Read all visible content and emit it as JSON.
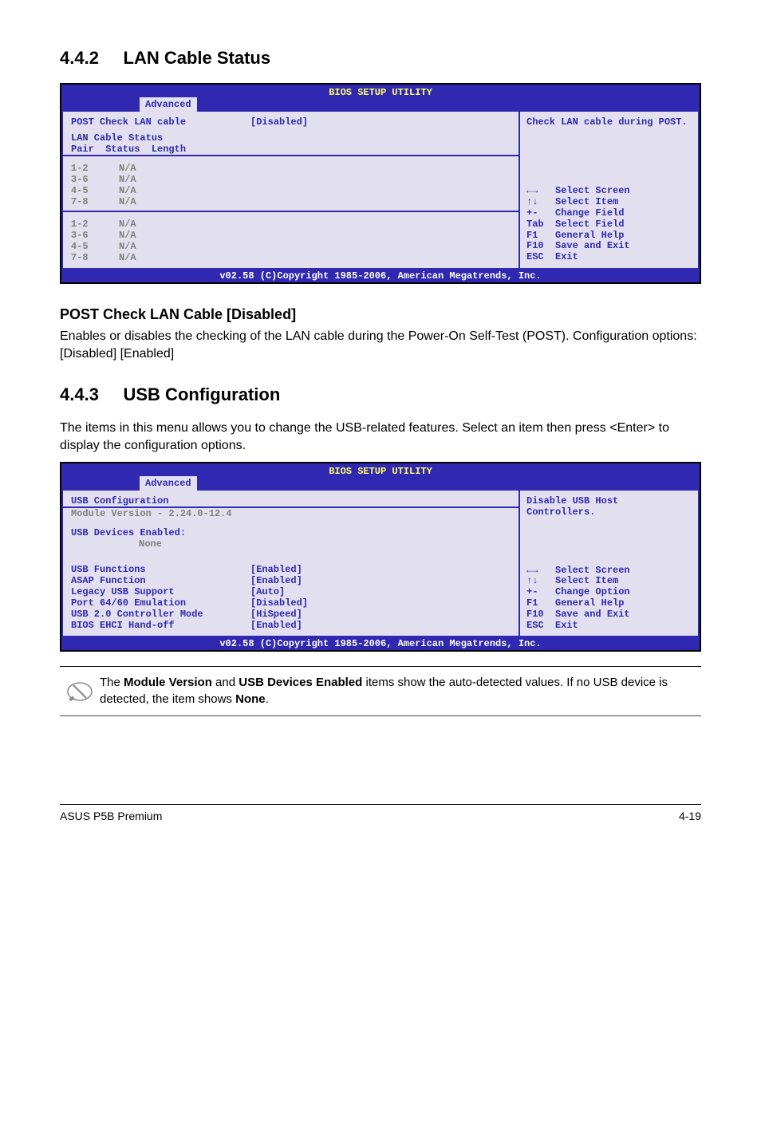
{
  "section1": {
    "num": "4.4.2",
    "title": "LAN Cable Status"
  },
  "bios1": {
    "title": "BIOS SETUP UTILITY",
    "tab": "Advanced",
    "left": {
      "post_check_label": "POST Check LAN cable",
      "post_check_value": "[Disabled]",
      "lan_status_hdr": "LAN Cable Status",
      "col_hdr": "Pair  Status  Length",
      "pairs1": [
        {
          "p": "1-2",
          "s": "N/A"
        },
        {
          "p": "3-6",
          "s": "N/A"
        },
        {
          "p": "4-5",
          "s": "N/A"
        },
        {
          "p": "7-8",
          "s": "N/A"
        }
      ],
      "pairs2": [
        {
          "p": "1-2",
          "s": "N/A"
        },
        {
          "p": "3-6",
          "s": "N/A"
        },
        {
          "p": "4-5",
          "s": "N/A"
        },
        {
          "p": "7-8",
          "s": "N/A"
        }
      ]
    },
    "right": {
      "help": "Check LAN cable during POST.",
      "keys": "←→   Select Screen\n↑↓   Select Item\n+-   Change Field\nTab  Select Field\nF1   General Help\nF10  Save and Exit\nESC  Exit"
    },
    "footer": "v02.58 (C)Copyright 1985-2006, American Megatrends, Inc."
  },
  "sub1": {
    "heading": "POST Check LAN Cable [Disabled]",
    "text": "Enables or disables the checking of the LAN cable during the Power-On Self-Test (POST). Configuration options: [Disabled] [Enabled]"
  },
  "section2": {
    "num": "4.4.3",
    "title": "USB Configuration"
  },
  "s2text": "The items in this menu allows you to change the USB-related features. Select an item then press <Enter> to display the configuration options.",
  "bios2": {
    "title": "BIOS SETUP UTILITY",
    "tab": "Advanced",
    "left": {
      "hdr": "USB Configuration",
      "module": "Module Version - 2.24.0-12.4",
      "dev_hdr": "USB Devices Enabled:",
      "dev_val": "None",
      "rows": [
        {
          "l": "USB Functions",
          "v": "[Enabled]"
        },
        {
          "l": "ASAP Function",
          "v": "[Enabled]"
        },
        {
          "l": "Legacy USB Support",
          "v": "[Auto]"
        },
        {
          "l": "Port 64/60 Emulation",
          "v": "[Disabled]"
        },
        {
          "l": "USB 2.0 Controller Mode",
          "v": "[HiSpeed]"
        },
        {
          "l": "BIOS EHCI Hand-off",
          "v": "[Enabled]"
        }
      ]
    },
    "right": {
      "help": "Disable USB Host Controllers.",
      "keys": "←→   Select Screen\n↑↓   Select Item\n+-   Change Option\nF1   General Help\nF10  Save and Exit\nESC  Exit"
    },
    "footer": "v02.58 (C)Copyright 1985-2006, American Megatrends, Inc."
  },
  "note": {
    "t1": "The ",
    "b1": "Module Version",
    "t2": " and ",
    "b2": "USB Devices Enabled",
    "t3": " items show the auto-detected values. If no USB device is detected, the item shows ",
    "b3": "None",
    "t4": "."
  },
  "footer": {
    "left": "ASUS P5B Premium",
    "right": "4-19"
  }
}
